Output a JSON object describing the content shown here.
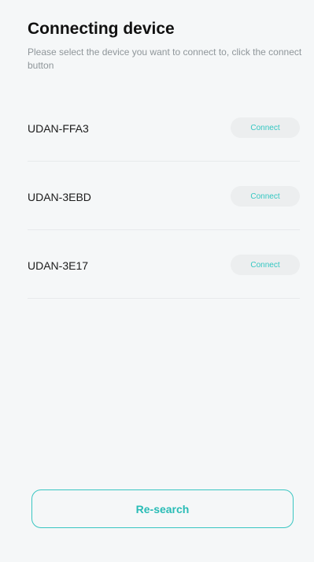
{
  "header": {
    "title": "Connecting device",
    "subtitle": "Please select the device you want to connect to, click the connect button"
  },
  "devices": [
    {
      "name": "UDAN-FFA3",
      "button_label": "Connect"
    },
    {
      "name": "UDAN-3EBD",
      "button_label": "Connect"
    },
    {
      "name": "UDAN-3E17",
      "button_label": "Connect"
    }
  ],
  "footer": {
    "research_label": "Re-search"
  },
  "colors": {
    "accent": "#39c6c2",
    "background": "#f5f7f8",
    "button_bg": "#eceeef"
  }
}
